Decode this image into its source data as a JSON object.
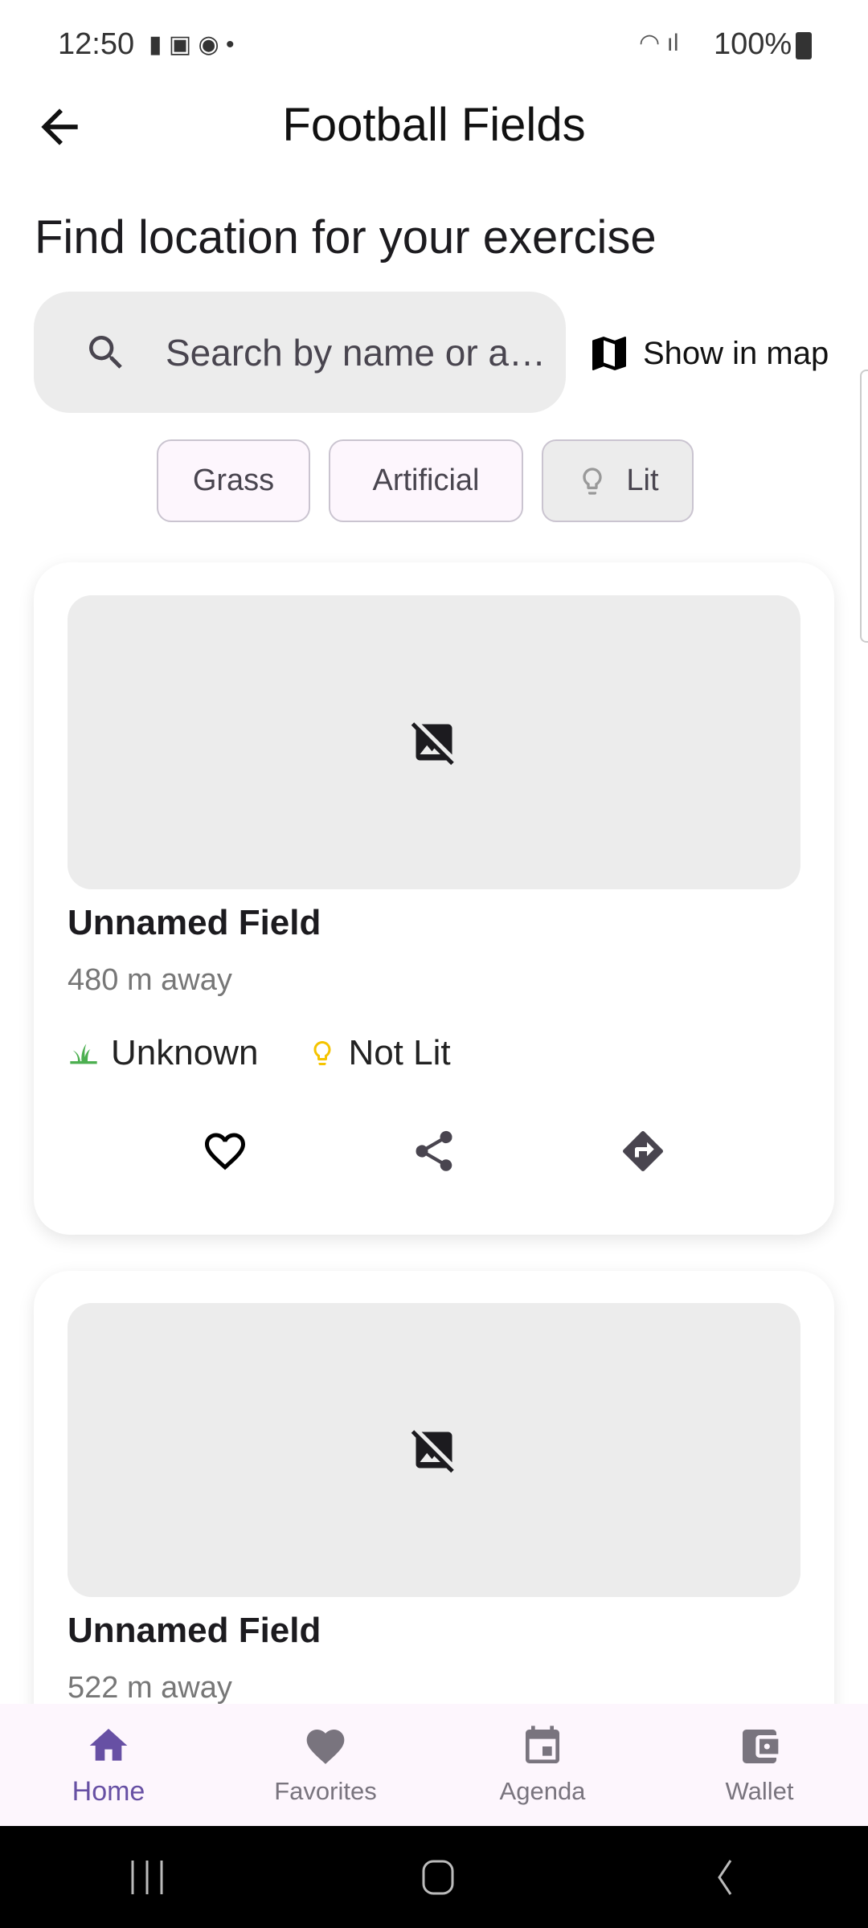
{
  "status_bar": {
    "time": "12:50",
    "battery": "100%"
  },
  "app_bar": {
    "title": "Football Fields"
  },
  "heading": "Find location for your exercise",
  "search": {
    "placeholder": "Search by name or a…"
  },
  "show_in_map": "Show in map",
  "filters": [
    {
      "label": "Grass"
    },
    {
      "label": "Artificial"
    },
    {
      "label": "Lit"
    }
  ],
  "fields": [
    {
      "name": "Unnamed Field",
      "distance": "480 m away",
      "surface": "Unknown",
      "lighting": "Not Lit"
    },
    {
      "name": "Unnamed Field",
      "distance": "522 m away"
    }
  ],
  "bottom_nav": [
    {
      "label": "Home"
    },
    {
      "label": "Favorites"
    },
    {
      "label": "Agenda"
    },
    {
      "label": "Wallet"
    }
  ],
  "colors": {
    "accent": "#6750a4",
    "grass": "#4caf50",
    "bulb": "#f5c400",
    "chip_bg": "#fdf6fd"
  }
}
